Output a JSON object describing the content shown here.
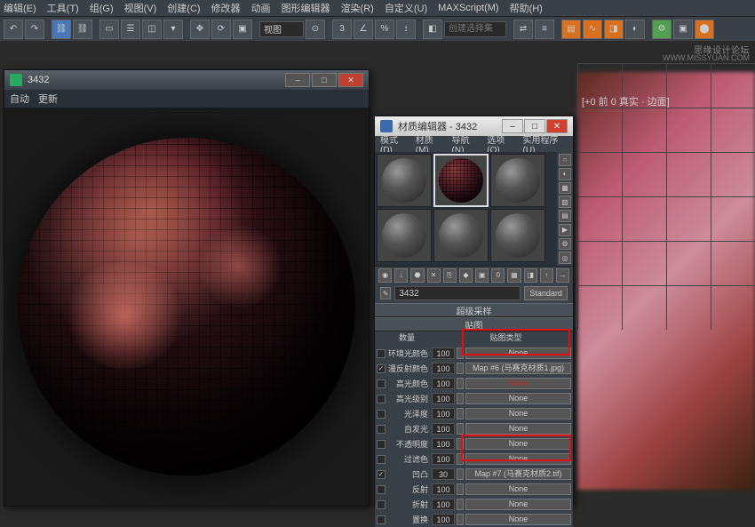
{
  "menubar": [
    "编辑(E)",
    "工具(T)",
    "组(G)",
    "视图(V)",
    "创建(C)",
    "修改器",
    "动画",
    "图形编辑器",
    "渲染(R)",
    "自定义(U)",
    "MAXScript(M)",
    "帮助(H)"
  ],
  "toolbar": {
    "conn_label": "创建选择集",
    "field_label": "视图"
  },
  "watermark": {
    "title": "思缘设计论坛",
    "url": "WWW.MISSYUAN.COM"
  },
  "viewport_label": "[+0 前 0 真实 · 边面]",
  "sphere_window": {
    "title": "3432",
    "tab_auto": "自动",
    "tab_update": "更新"
  },
  "material_editor": {
    "title": "材质编辑器 - 3432",
    "menu": [
      "模式(D)",
      "材质(M)",
      "导航(N)",
      "选项(O)",
      "实用程序(U)"
    ],
    "material_name": "3432",
    "shader_type": "Standard",
    "rollout_super": "超级采样",
    "rollout_maps": "贴图",
    "col_amount": "数量",
    "col_maptype": "贴图类型",
    "map_none": "None",
    "maps": [
      {
        "on": false,
        "label": "环境光颜色",
        "amount": 100,
        "slot": "None",
        "red": false
      },
      {
        "on": true,
        "label": "漫反射颜色",
        "amount": 100,
        "slot": "Map #6 (马赛克材质1.jpg)",
        "red": false
      },
      {
        "on": false,
        "label": "高光颜色",
        "amount": 100,
        "slot": "None",
        "red": true
      },
      {
        "on": false,
        "label": "高光级别",
        "amount": 100,
        "slot": "None",
        "red": false
      },
      {
        "on": false,
        "label": "光泽度",
        "amount": 100,
        "slot": "None",
        "red": false
      },
      {
        "on": false,
        "label": "自发光",
        "amount": 100,
        "slot": "None",
        "red": false
      },
      {
        "on": false,
        "label": "不透明度",
        "amount": 100,
        "slot": "None",
        "red": false
      },
      {
        "on": false,
        "label": "过滤色",
        "amount": 100,
        "slot": "None",
        "red": false
      },
      {
        "on": true,
        "label": "凹凸",
        "amount": 30,
        "slot": "Map #7 (马赛克材质2.tif)",
        "red": false
      },
      {
        "on": false,
        "label": "反射",
        "amount": 100,
        "slot": "None",
        "red": false
      },
      {
        "on": false,
        "label": "折射",
        "amount": 100,
        "slot": "None",
        "red": false
      },
      {
        "on": false,
        "label": "置换",
        "amount": 100,
        "slot": "None",
        "red": false
      }
    ]
  }
}
